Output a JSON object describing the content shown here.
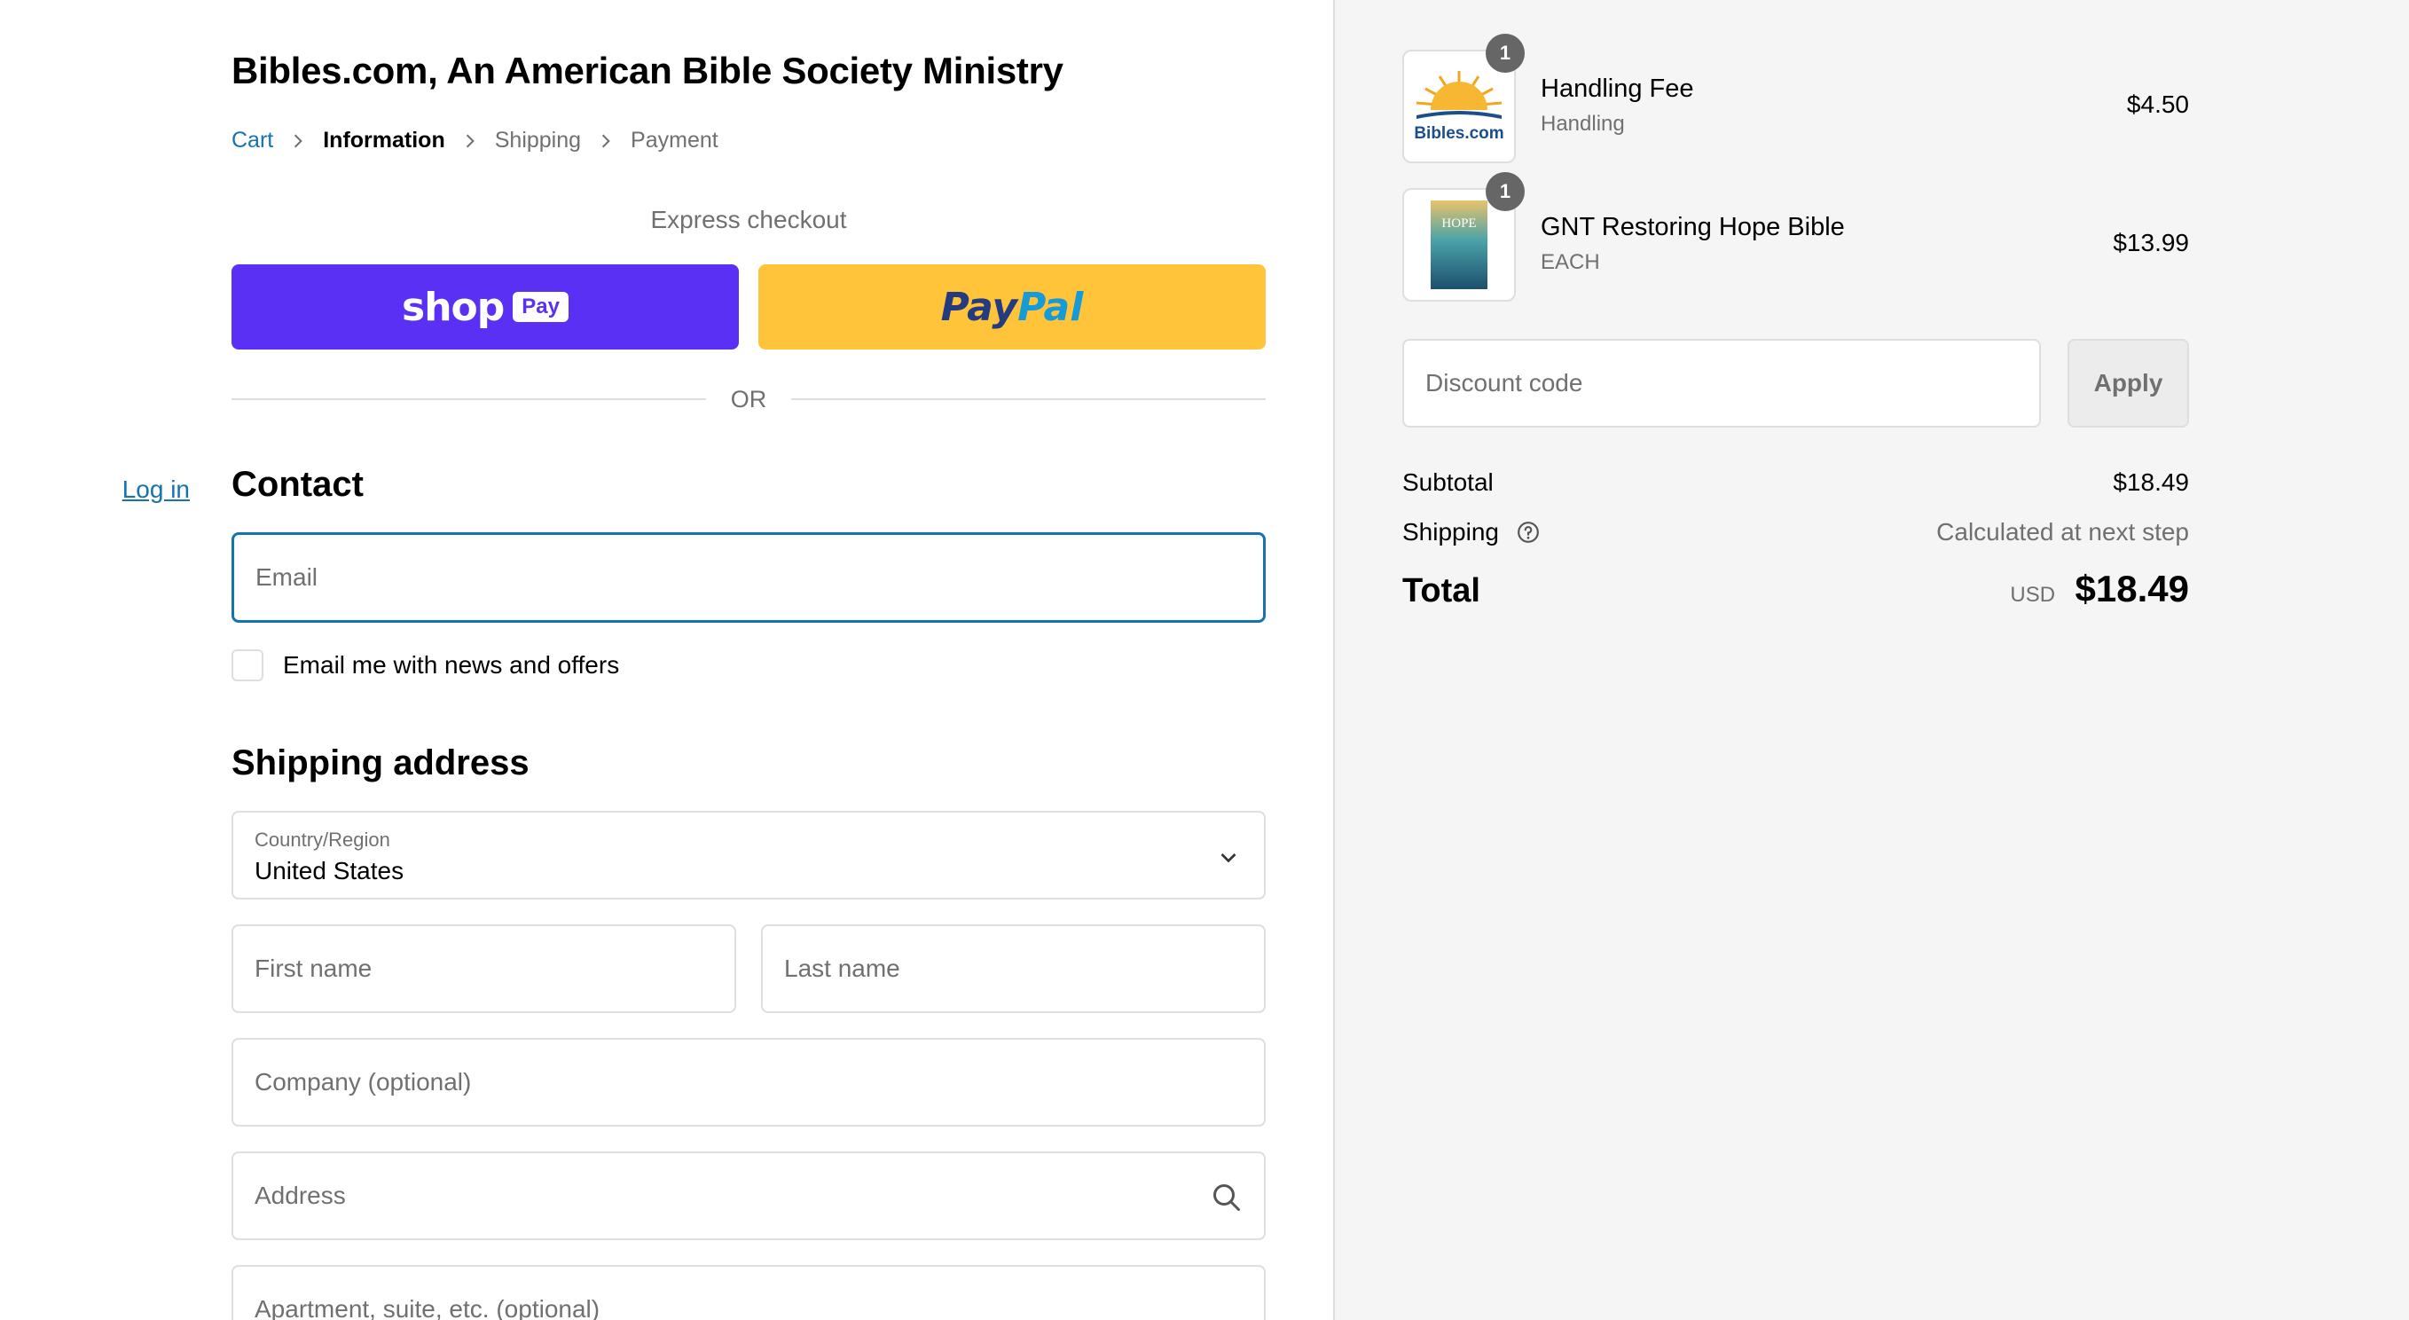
{
  "shop": {
    "title": "Bibles.com, An American Bible Society Ministry"
  },
  "breadcrumb": {
    "cart": "Cart",
    "information": "Information",
    "shipping": "Shipping",
    "payment": "Payment"
  },
  "express": {
    "label": "Express checkout",
    "shop_word": "shop",
    "shop_pay": "Pay",
    "paypal_1": "Pay",
    "paypal_2": "Pal",
    "or": "OR"
  },
  "contact": {
    "heading": "Contact",
    "login": "Log in",
    "email_placeholder": "Email",
    "newsletter": "Email me with news and offers"
  },
  "shipping": {
    "heading": "Shipping address",
    "country_label": "Country/Region",
    "country_value": "United States",
    "first_name": "First name",
    "last_name": "Last name",
    "company": "Company (optional)",
    "address": "Address",
    "apartment": "Apartment, suite, etc. (optional)"
  },
  "order": {
    "items": [
      {
        "name": "Handling Fee",
        "sub": "Handling",
        "price": "$4.50",
        "qty": "1",
        "thumb_text": "Bibles.com"
      },
      {
        "name": "GNT Restoring Hope Bible",
        "sub": "EACH",
        "price": "$13.99",
        "qty": "1",
        "thumb_text": "HOPE"
      }
    ],
    "discount_placeholder": "Discount code",
    "apply": "Apply",
    "subtotal_label": "Subtotal",
    "subtotal_value": "$18.49",
    "shipping_label": "Shipping",
    "shipping_value": "Calculated at next step",
    "total_label": "Total",
    "currency": "USD",
    "total_value": "$18.49"
  },
  "colors": {
    "accent": "#1773b0",
    "shop_pay": "#5a31f4",
    "paypal": "#ffc439"
  }
}
